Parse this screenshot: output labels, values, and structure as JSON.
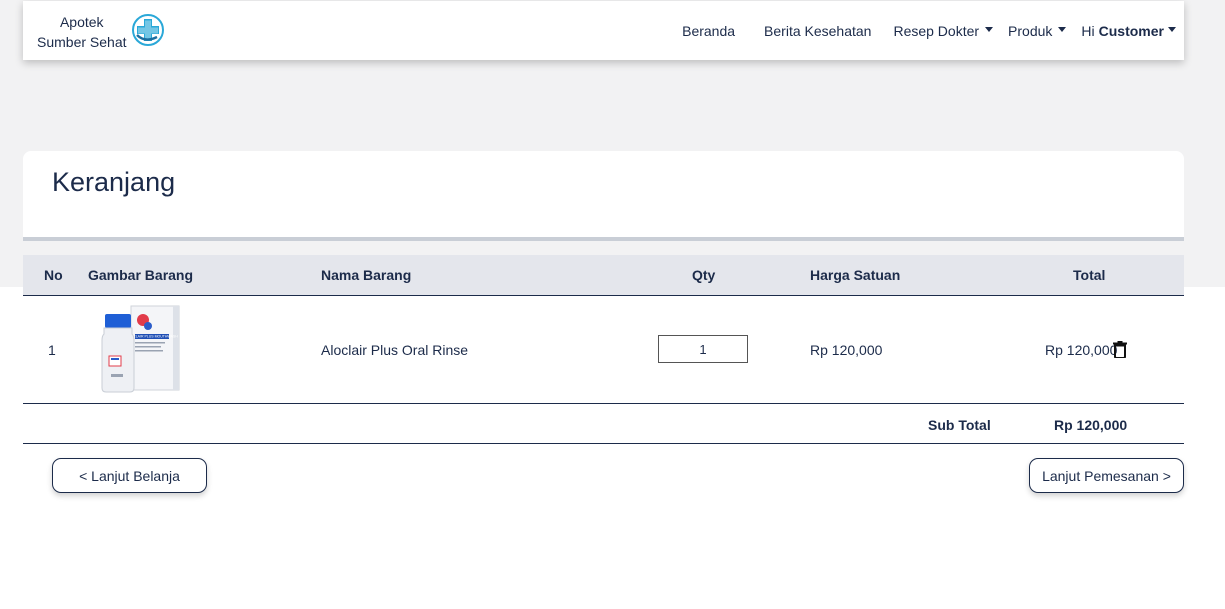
{
  "brand": {
    "line1": "Apotek",
    "line2": "Sumber Sehat",
    "logo_icon": "medical-cross-logo"
  },
  "nav": {
    "home": "Beranda",
    "health_news": "Berita Kesehatan",
    "prescription": "Resep Dokter",
    "products": "Produk",
    "greeting": "Hi",
    "user": "Customer"
  },
  "page": {
    "title": "Keranjang"
  },
  "table": {
    "headers": {
      "no": "No",
      "image": "Gambar Barang",
      "name": "Nama Barang",
      "qty": "Qty",
      "unit_price": "Harga Satuan",
      "total": "Total"
    },
    "rows": [
      {
        "no": "1",
        "name": "Aloclair Plus Oral Rinse",
        "qty": "1",
        "unit_price": "Rp 120,000",
        "total": "Rp 120,000",
        "image_icon": "aloclair-product-image",
        "image_label": "ALOCLAIR PLUS MOUTHWASH"
      }
    ],
    "subtotal_label": "Sub Total",
    "subtotal_value": "Rp 120,000"
  },
  "actions": {
    "continue_shopping": "< Lanjut Belanja",
    "continue_order": "Lanjut Pemesanan >"
  },
  "colors": {
    "primary_text": "#1c2b4a",
    "header_bg": "#e4e6ec",
    "page_bg": "#f2f2f3",
    "logo_accent": "#2aa8d8"
  }
}
